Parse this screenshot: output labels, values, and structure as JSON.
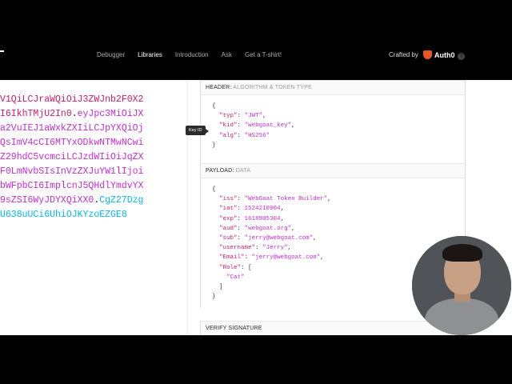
{
  "nav": {
    "items": [
      "Debugger",
      "Libraries",
      "Introduction",
      "Ask",
      "Get a T-shirt!"
    ],
    "active": "Libraries",
    "crafted_by": "Crafted by",
    "brand": "Auth0",
    "help": "?"
  },
  "encoded": {
    "lines": [
      [
        {
          "t": "V1QiLCJraWQiOiJ3ZWJnb2F0X2",
          "c": "hdr"
        }
      ],
      [
        {
          "t": "I6IkhTMjU2In0",
          "c": "hdr"
        },
        {
          "t": ".",
          "c": "dot"
        },
        {
          "t": "eyJpc3MiOiJX",
          "c": "pay"
        }
      ],
      [
        {
          "t": "a2VuIEJ1aWxkZXIiLCJpYXQiOj",
          "c": "pay"
        }
      ],
      [
        {
          "t": "QsImV4cCI6MTYxODkwNTMwNCwi",
          "c": "pay"
        }
      ],
      [
        {
          "t": "Z29hdC5vcmciLCJzdWIiOiJqZX",
          "c": "pay"
        }
      ],
      [
        {
          "t": "F0LmNvbSIsInVzZXJuYW1lIjoi",
          "c": "pay"
        }
      ],
      [
        {
          "t": "bWFpbCI6ImplcnJ5QHdlYmdvYX",
          "c": "pay"
        }
      ],
      [
        {
          "t": "9sZSI6WyJDYXQiXX0",
          "c": "pay"
        },
        {
          "t": ".",
          "c": "dot"
        },
        {
          "t": "CgZ27Dzg",
          "c": "sig"
        }
      ],
      [
        {
          "t": "U638uUCi6UhiOJKYzoEZGE8",
          "c": "sig"
        }
      ]
    ]
  },
  "header_section": {
    "title": "HEADER:",
    "subtitle": "ALGORITHM & TOKEN TYPE",
    "json": {
      "typ": "JWT",
      "kid": "webgoat_key",
      "alg": "HS256"
    }
  },
  "tooltip": "Key ID",
  "payload_section": {
    "title": "PAYLOAD:",
    "subtitle": "DATA",
    "json": {
      "iss": "WebGoat Token Builder",
      "iat": "1524210904",
      "exp": "1618905304",
      "aud": "webgoat.org",
      "sub": "jerry@webgoat.com",
      "username": "Jerry",
      "Email": "jerry@webgoat.com",
      "Role": "Cat"
    }
  },
  "verify_section": {
    "title": "VERIFY SIGNATURE"
  }
}
